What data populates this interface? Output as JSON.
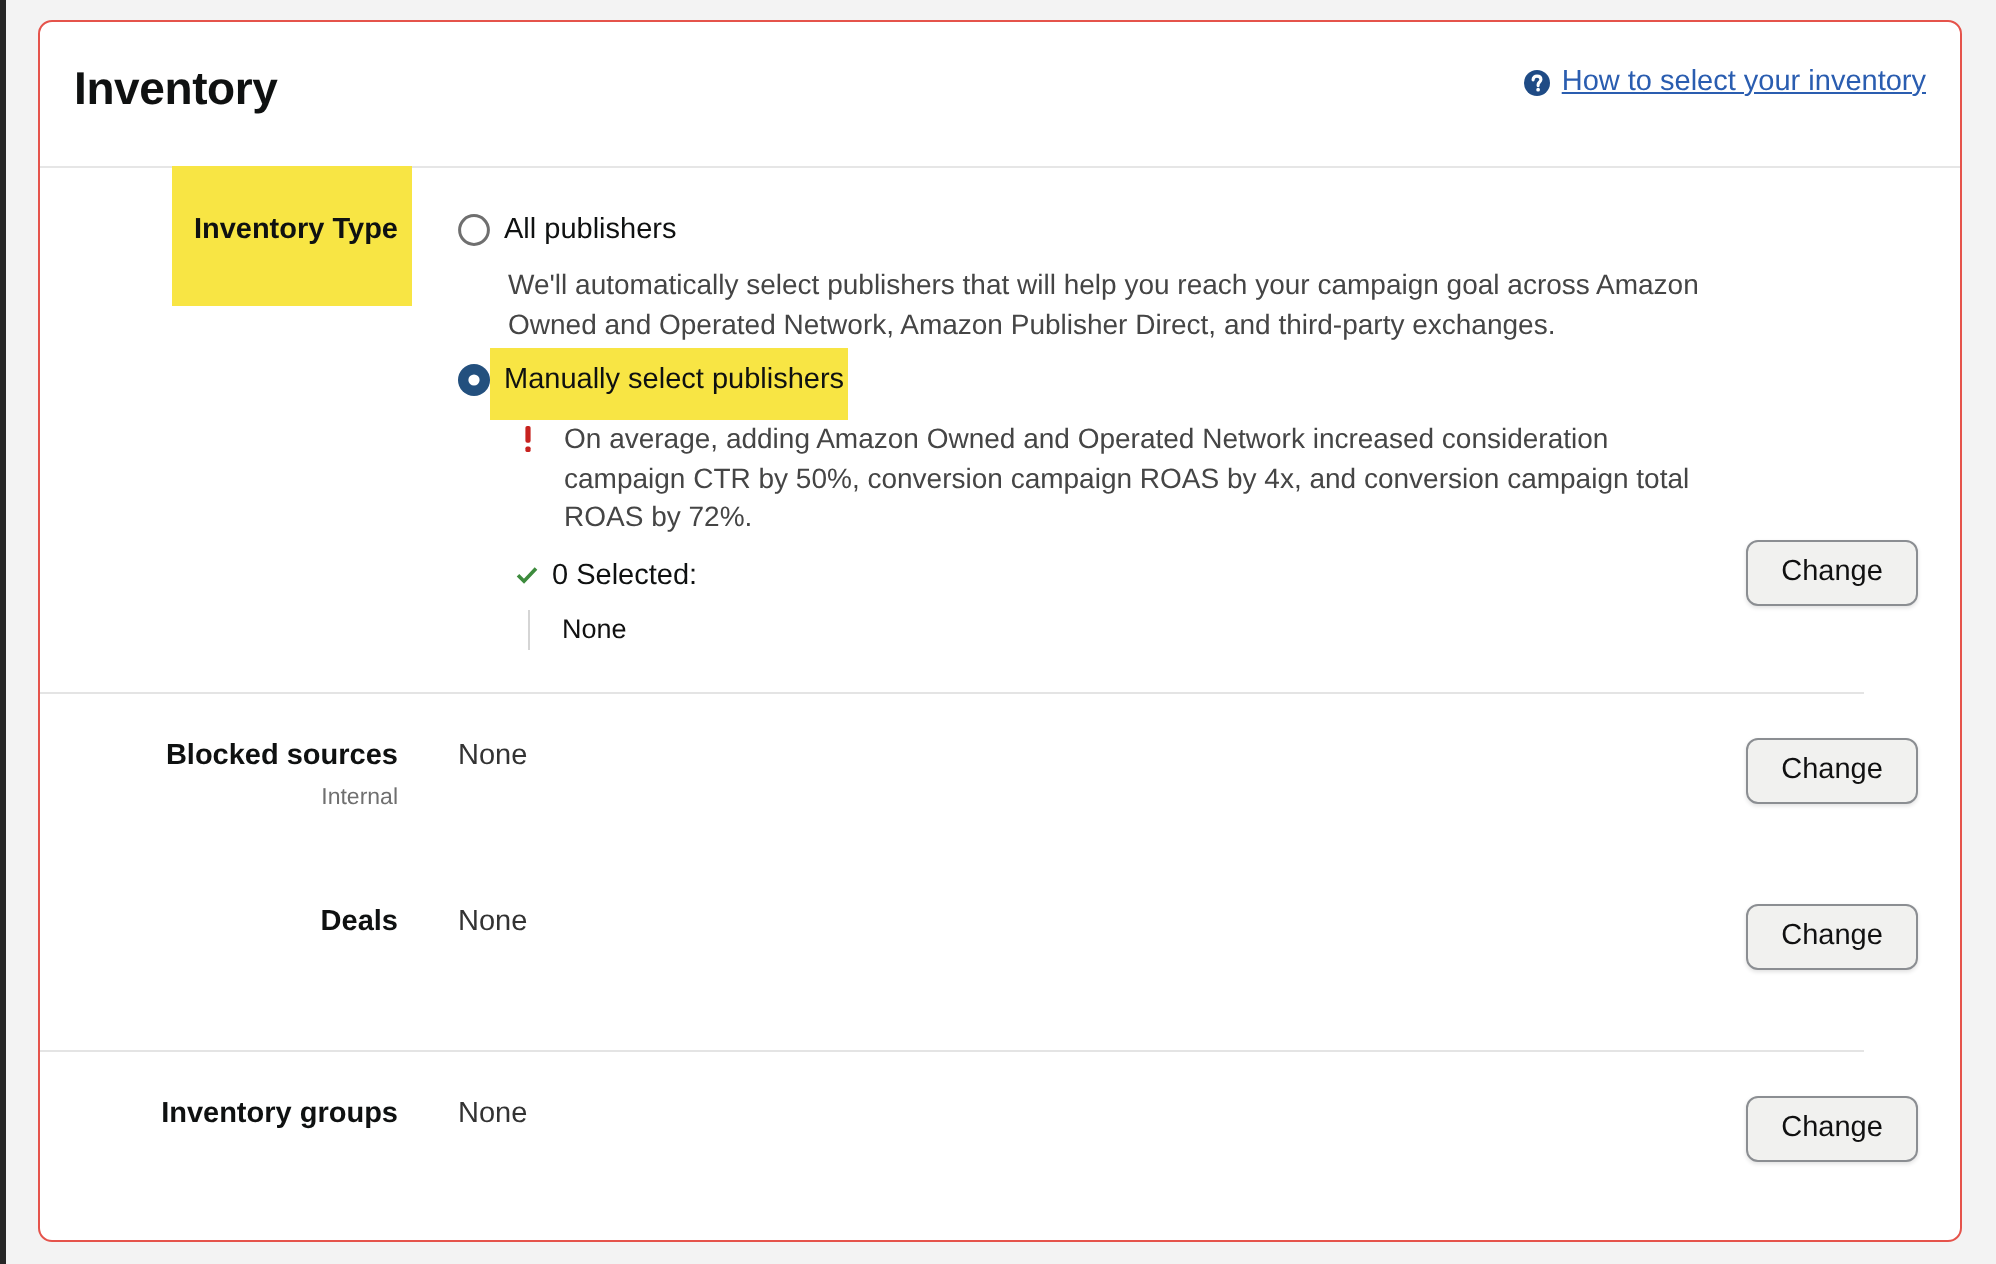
{
  "header": {
    "title": "Inventory",
    "help_link": "How to select your inventory"
  },
  "sections": [
    {
      "rows": [
        {
          "kind": "options",
          "label": "Inventory Type",
          "highlighted": true,
          "button": "Change",
          "options": [
            {
              "label": "All publishers",
              "selected": false,
              "highlighted": false,
              "description": "We'll automatically select publishers that will help you reach your campaign goal across Amazon Owned and Operated Network, Amazon Publisher Direct, and third-party exchanges."
            },
            {
              "label": "Manually select publishers",
              "selected": true,
              "highlighted": true,
              "alert": "On average, adding Amazon Owned and Operated Network increased consideration campaign CTR by 50%, conversion campaign ROAS by 4x, and conversion campaign total ROAS by 72%.",
              "selection_summary": "0 Selected:",
              "selection_items": [
                "None"
              ]
            }
          ]
        }
      ]
    },
    {
      "rows": [
        {
          "kind": "value",
          "label": "Blocked sources",
          "highlighted": false,
          "sublabel": "Internal",
          "value": "None",
          "button": "Change"
        },
        {
          "kind": "value",
          "label": "Deals",
          "highlighted": false,
          "value": "None",
          "button": "Change"
        }
      ]
    },
    {
      "rows": [
        {
          "kind": "value",
          "label": "Inventory groups",
          "highlighted": false,
          "value": "None",
          "button": "Change"
        }
      ]
    }
  ]
}
